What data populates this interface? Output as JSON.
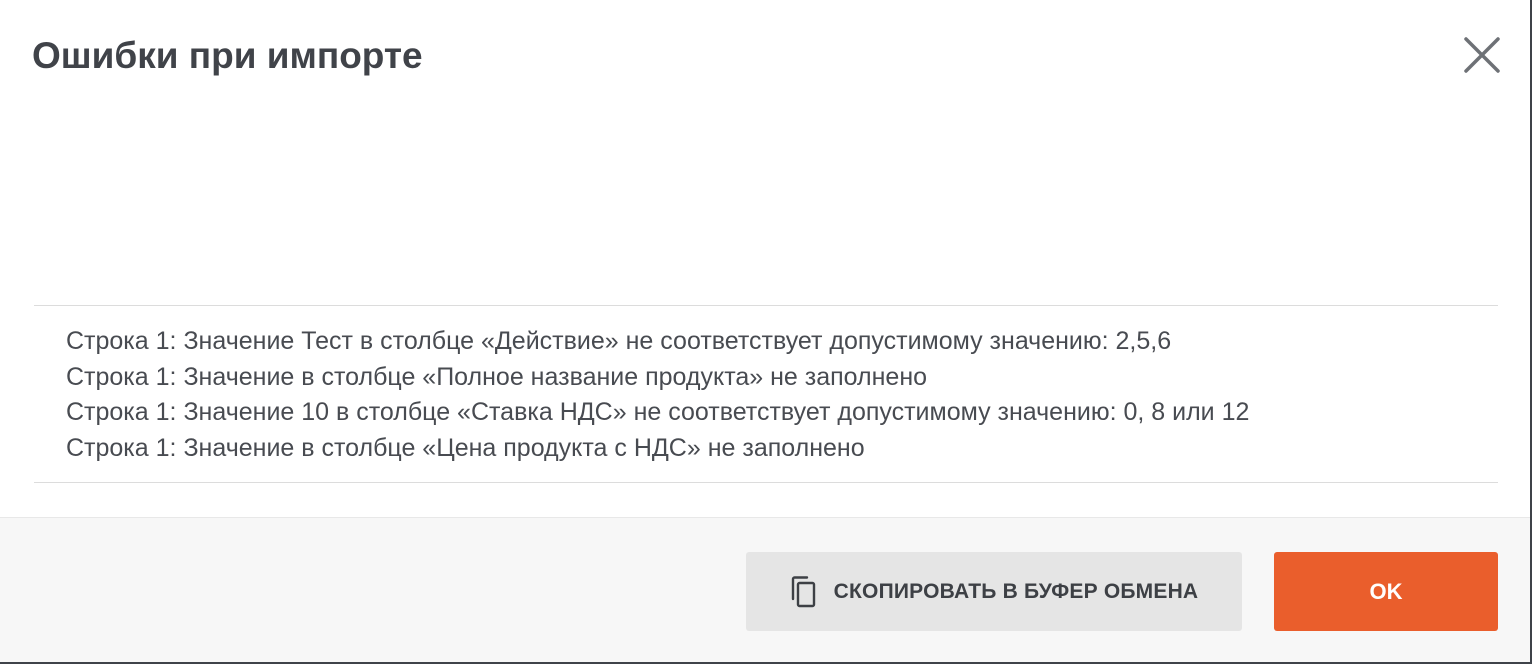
{
  "dialog": {
    "title": "Ошибки при импорте",
    "close_icon": "close-icon"
  },
  "errors": [
    "Строка 1: Значение Тест в столбце «Действие» не соответствует допустимому значению: 2,5,6",
    "Строка 1: Значение в столбце «Полное название продукта» не заполнено",
    "Строка 1: Значение 10 в столбце «Ставка НДС» не соответствует допустимому значению: 0, 8 или 12",
    "Строка 1: Значение в столбце «Цена продукта с НДС» не заполнено"
  ],
  "footer": {
    "copy_label": "СКОПИРОВАТЬ В БУФЕР ОБМЕНА",
    "copy_icon": "copy-icon",
    "ok_label": "OK"
  },
  "colors": {
    "accent": "#ea5e2c",
    "title_text": "#404349",
    "body_text": "#484b51",
    "secondary_button_bg": "#e5e5e5",
    "footer_bg": "#f7f7f7"
  }
}
